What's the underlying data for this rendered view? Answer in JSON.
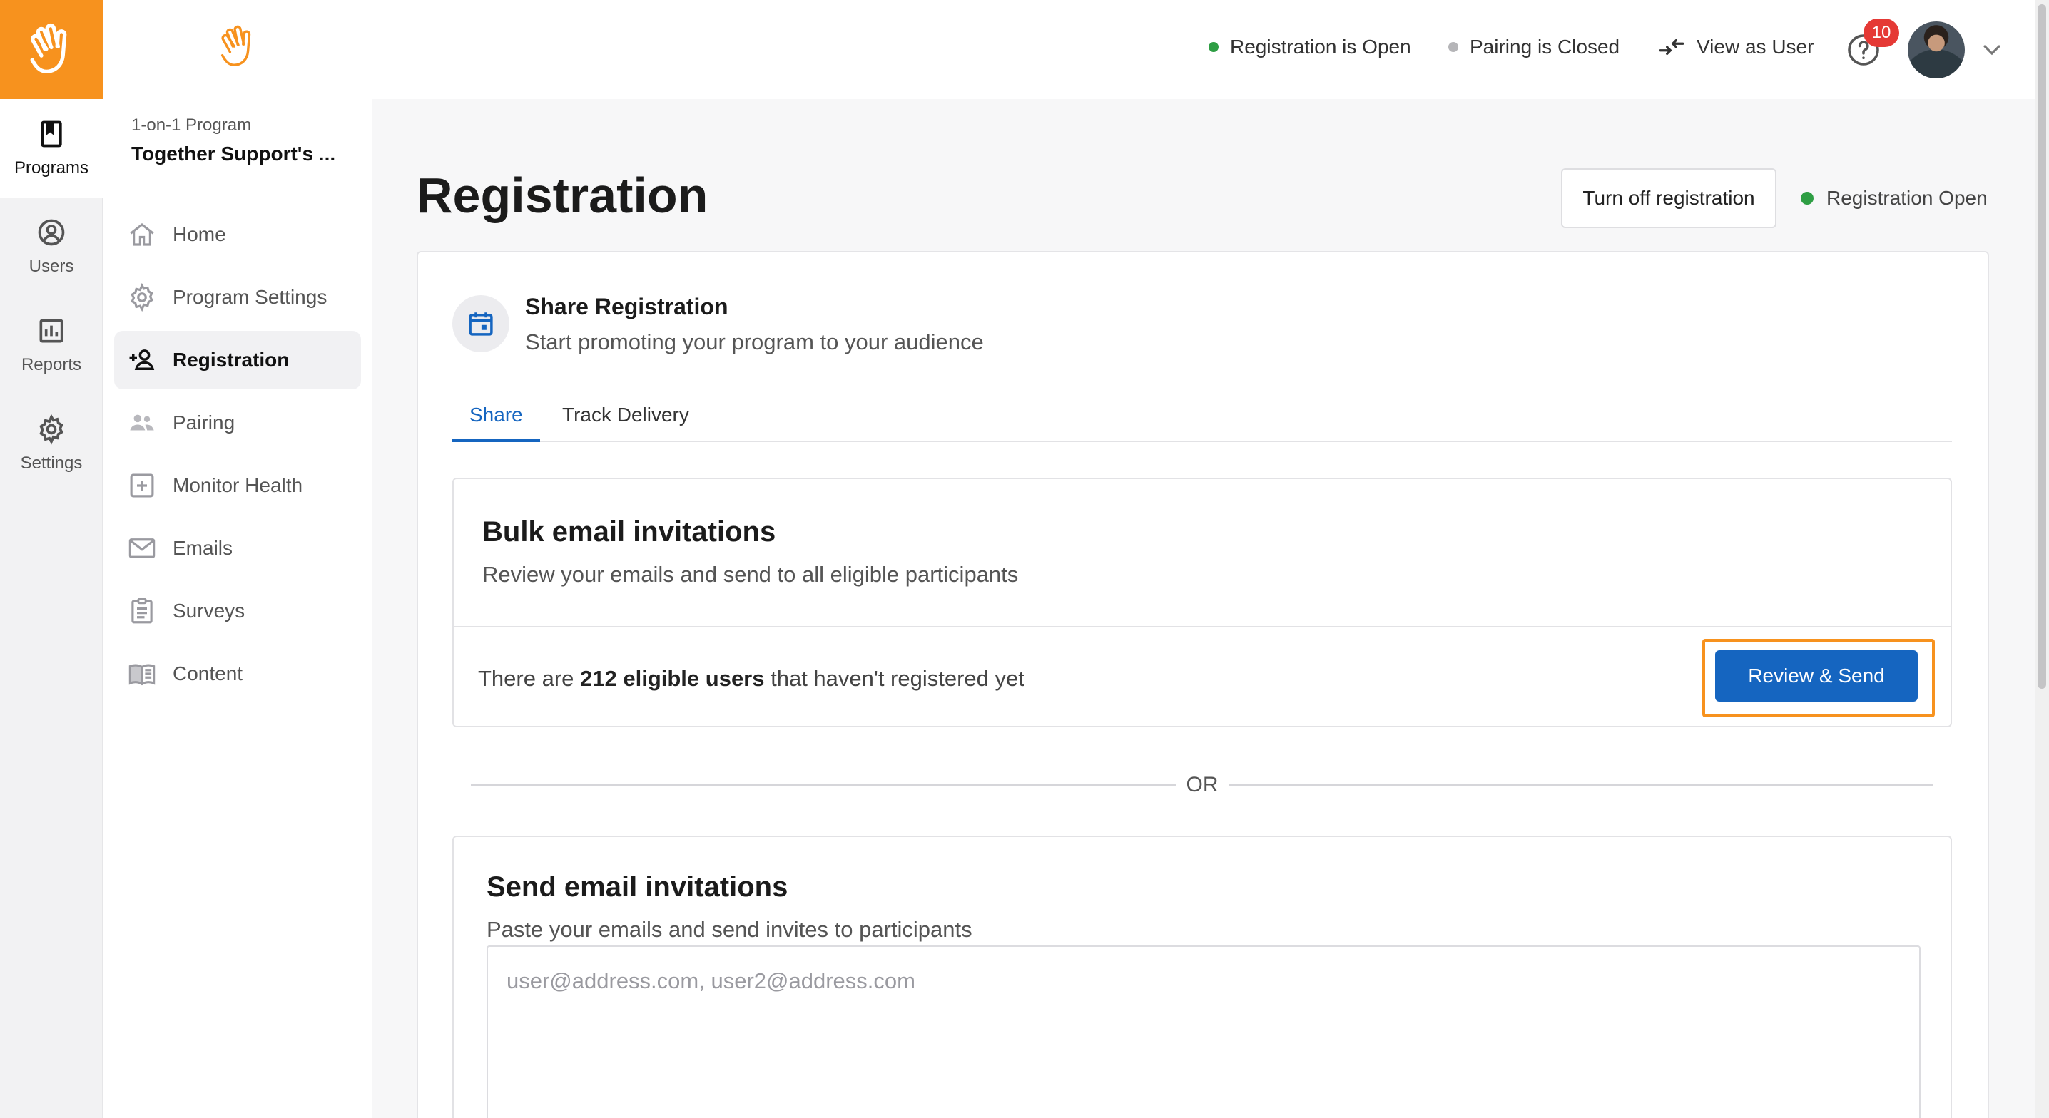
{
  "colors": {
    "brand_orange": "#f7921e",
    "primary_blue": "#1565c0",
    "status_green": "#2e9e44",
    "status_gray": "#b5b5b8",
    "badge_red": "#e53935"
  },
  "rail": {
    "items": [
      {
        "label": "Programs",
        "icon": "bookmark-icon",
        "active": true
      },
      {
        "label": "Users",
        "icon": "user-circle-icon"
      },
      {
        "label": "Reports",
        "icon": "bar-chart-icon"
      },
      {
        "label": "Settings",
        "icon": "gear-icon"
      }
    ]
  },
  "sidebar": {
    "caption": "1-on-1 Program",
    "program_name": "Together Support's ...",
    "items": [
      {
        "label": "Home",
        "icon": "home-icon"
      },
      {
        "label": "Program Settings",
        "icon": "gear-icon"
      },
      {
        "label": "Registration",
        "icon": "add-user-icon",
        "active": true
      },
      {
        "label": "Pairing",
        "icon": "users-icon"
      },
      {
        "label": "Monitor Health",
        "icon": "plus-square-icon"
      },
      {
        "label": "Emails",
        "icon": "mail-icon"
      },
      {
        "label": "Surveys",
        "icon": "clipboard-icon"
      },
      {
        "label": "Content",
        "icon": "book-icon"
      }
    ]
  },
  "topbar": {
    "registration_status": "Registration is Open",
    "pairing_status": "Pairing is Closed",
    "view_as_user": "View as User",
    "notification_count": "10"
  },
  "page": {
    "title": "Registration",
    "turn_off_button": "Turn off registration",
    "registration_state": "Registration Open"
  },
  "share": {
    "title": "Share Registration",
    "subtitle": "Start promoting your program to your audience",
    "tabs": [
      {
        "label": "Share",
        "active": true
      },
      {
        "label": "Track Delivery"
      }
    ]
  },
  "bulk": {
    "title": "Bulk email invitations",
    "subtitle": "Review your emails and send to all eligible participants",
    "text_prefix": "There are ",
    "text_bold": "212 eligible users",
    "text_suffix": " that haven't registered yet",
    "button": "Review & Send"
  },
  "or_label": "OR",
  "send": {
    "title": "Send email invitations",
    "subtitle": "Paste your emails and send invites to participants",
    "placeholder": "user@address.com, user2@address.com",
    "value": ""
  }
}
